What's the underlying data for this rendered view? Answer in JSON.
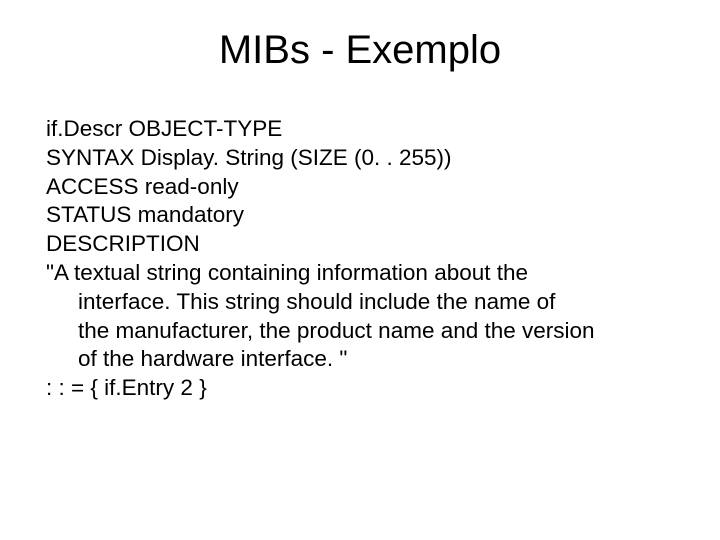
{
  "title": "MIBs - Exemplo",
  "lines": {
    "l1": "if.Descr OBJECT-TYPE",
    "l2": "SYNTAX  Display. String (SIZE (0. . 255))",
    "l3": "ACCESS  read-only",
    "l4": "STATUS  mandatory",
    "l5": "DESCRIPTION",
    "l6": "\"A textual string containing information about the",
    "l7": "interface.  This string should include the name of",
    "l8": "the manufacturer, the product name and the version",
    "l9": "of the hardware interface. \"",
    "l10": ": : = { if.Entry 2 }"
  }
}
